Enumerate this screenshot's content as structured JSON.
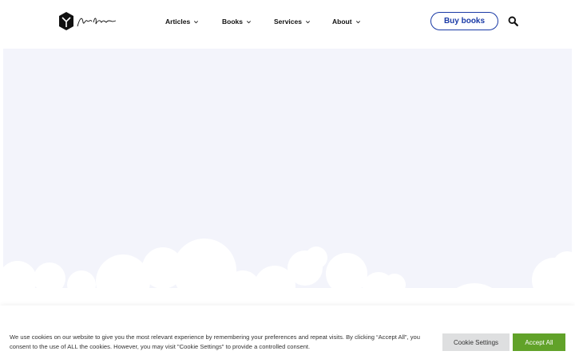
{
  "header": {
    "logo_icon": "hexagon-monogram-icon",
    "nav": [
      {
        "label": "Articles",
        "icon": "chevron-down-icon"
      },
      {
        "label": "Books",
        "icon": "chevron-down-icon"
      },
      {
        "label": "Services",
        "icon": "chevron-down-icon"
      },
      {
        "label": "About",
        "icon": "chevron-down-icon"
      }
    ],
    "buy_label": "Buy books",
    "search_icon": "search-icon"
  },
  "colors": {
    "accent_blue": "#1a3aa6",
    "hero_bg": "#f3f4fb",
    "accept_green": "#61a229",
    "settings_grey": "#dedfe0"
  },
  "cookie": {
    "text": "We use cookies on our website to give you the most relevant experience by remembering your preferences and repeat visits. By clicking “Accept All”, you consent to the use of ALL the cookies. However, you may visit \"Cookie Settings\" to provide a controlled consent.",
    "settings_label": "Cookie Settings",
    "accept_label": "Accept All"
  }
}
